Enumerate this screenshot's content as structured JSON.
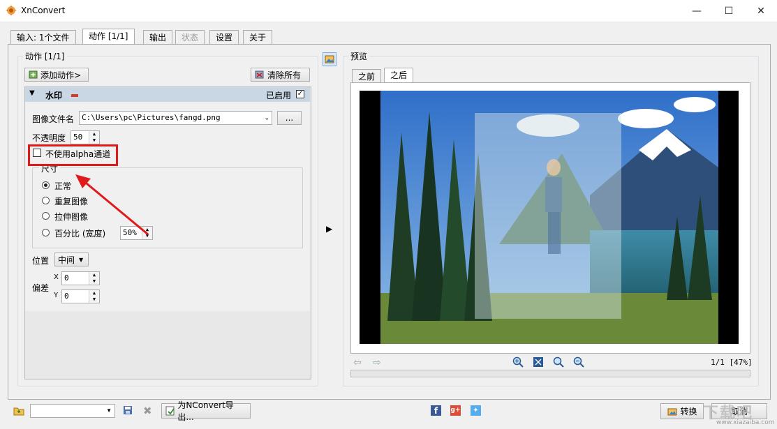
{
  "window": {
    "title": "XnConvert"
  },
  "tabs": [
    {
      "label": "输入: 1个文件"
    },
    {
      "label": "动作 [1/1]"
    },
    {
      "label": "输出"
    },
    {
      "label": "状态"
    },
    {
      "label": "设置"
    },
    {
      "label": "关于"
    }
  ],
  "actions": {
    "group_title": "动作 [1/1]",
    "add_button": "添加动作>",
    "clear_button": "清除所有"
  },
  "watermark": {
    "title": "水印",
    "enabled_label": "已启用",
    "enabled": true,
    "filename_label": "图像文件名",
    "filename_value": "C:\\Users\\pc\\Pictures\\fangd.png",
    "browse_label": "...",
    "opacity_label": "不透明度",
    "opacity_value": "50",
    "no_alpha_label": "不使用alpha通道",
    "size_group": "尺寸",
    "size_options": [
      {
        "label": "正常",
        "selected": true
      },
      {
        "label": "重复图像",
        "selected": false
      },
      {
        "label": "拉伸图像",
        "selected": false
      },
      {
        "label": "百分比 (宽度)",
        "selected": false
      }
    ],
    "percent_value": "50%",
    "position_label": "位置",
    "position_value": "中间",
    "offset_label": "偏差",
    "x_label": "X",
    "x_value": "0",
    "y_label": "Y",
    "y_value": "0"
  },
  "preview": {
    "title": "预览",
    "tabs": [
      {
        "label": "之前"
      },
      {
        "label": "之后"
      }
    ],
    "page_info": "1/1 [47%]"
  },
  "bottom": {
    "export_label": "为NConvert导出...",
    "convert_label": "转换",
    "cancel_label": "取消",
    "watermark_text": "下载吧",
    "watermark_url": "www.xiazaiba.com"
  },
  "colors": {
    "highlight": "#e0191b",
    "section_header": "#c9d6e3"
  }
}
